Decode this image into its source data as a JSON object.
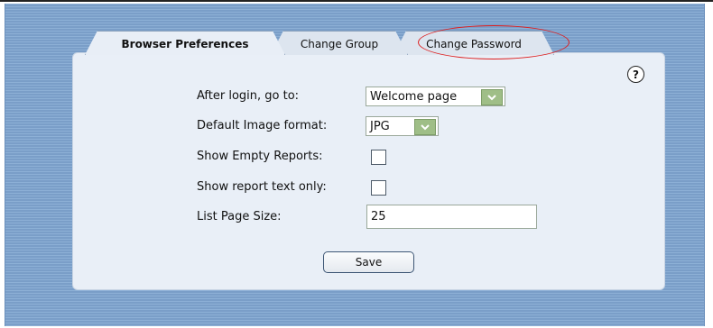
{
  "tabs": [
    {
      "label": "Browser Preferences",
      "active": true
    },
    {
      "label": "Change Group",
      "active": false
    },
    {
      "label": "Change Password",
      "active": false
    }
  ],
  "help": {
    "symbol": "?"
  },
  "form": {
    "after_login": {
      "label": "After login, go to:",
      "value": "Welcome page"
    },
    "image_format": {
      "label": "Default Image format:",
      "value": "JPG"
    },
    "show_empty": {
      "label": "Show Empty Reports:",
      "checked": false
    },
    "text_only": {
      "label": "Show report text only:",
      "checked": false
    },
    "page_size": {
      "label": "List Page Size:",
      "value": "25"
    },
    "save_label": "Save"
  },
  "colors": {
    "annotation": "#dd1f1f",
    "dropdown_arrow": "#9fbe87",
    "panel": "#e9eff7"
  }
}
